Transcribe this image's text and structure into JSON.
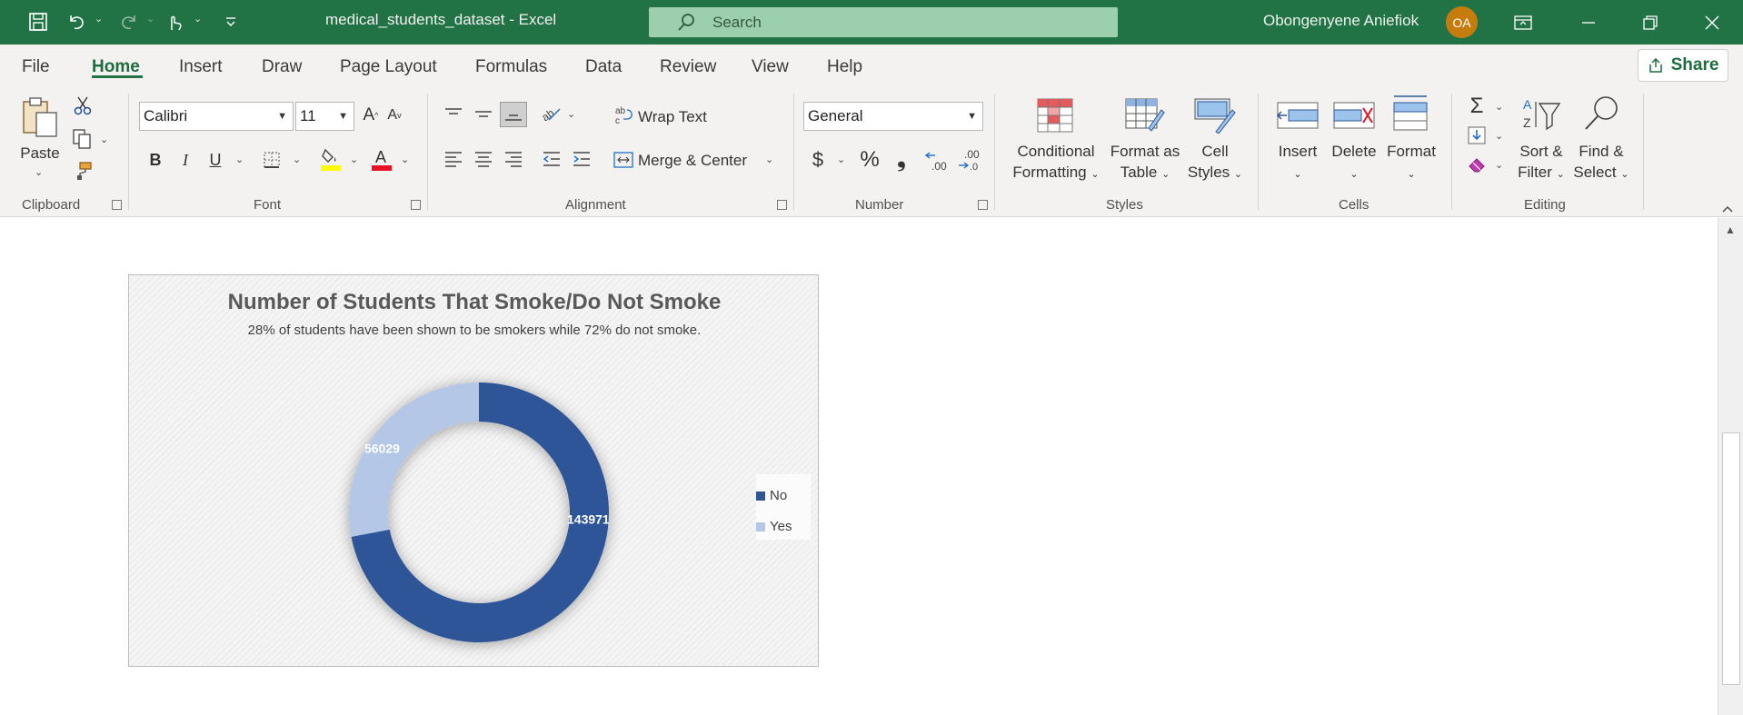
{
  "window": {
    "doc_title": "medical_students_dataset  -  Excel",
    "search_placeholder": "Search",
    "user_name": "Obongenyene Aniefiok",
    "user_initials": "OA",
    "accent": "#217346"
  },
  "tabs": [
    "File",
    "Home",
    "Insert",
    "Draw",
    "Page Layout",
    "Formulas",
    "Data",
    "Review",
    "View",
    "Help"
  ],
  "active_tab": "Home",
  "share_label": "Share",
  "ribbon": {
    "clipboard": {
      "paste": "Paste",
      "label": "Clipboard"
    },
    "font": {
      "name": "Calibri",
      "size": "11",
      "bold": "B",
      "italic": "I",
      "underline": "U",
      "label": "Font"
    },
    "alignment": {
      "wrap": "Wrap Text",
      "merge": "Merge & Center",
      "label": "Alignment"
    },
    "number": {
      "format": "General",
      "currency": "$",
      "percent": "%",
      "comma": "❟",
      "label": "Number"
    },
    "styles": {
      "conditional_1": "Conditional",
      "conditional_2": "Formatting",
      "format_table_1": "Format as",
      "format_table_2": "Table",
      "cell_styles_1": "Cell",
      "cell_styles_2": "Styles",
      "label": "Styles"
    },
    "cells": {
      "insert": "Insert",
      "delete": "Delete",
      "format": "Format",
      "label": "Cells"
    },
    "editing": {
      "sort_1": "Sort &",
      "sort_2": "Filter",
      "find_1": "Find &",
      "find_2": "Select",
      "label": "Editing"
    }
  },
  "chart_data": {
    "type": "donut",
    "title": "Number of Students That Smoke/Do Not Smoke",
    "subtitle": "28% of students have been shown to be smokers while 72% do not smoke.",
    "categories": [
      "No",
      "Yes"
    ],
    "values": [
      143971,
      56029
    ],
    "colors": [
      "#2f5597",
      "#b4c7e7"
    ],
    "legend_position": "right",
    "data_labels": [
      "143971",
      "56029"
    ]
  }
}
